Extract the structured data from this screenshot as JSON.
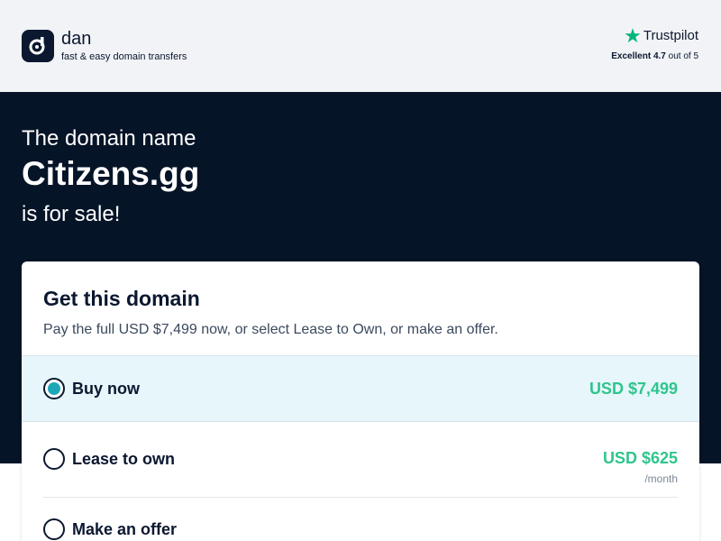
{
  "header": {
    "brand_name": "dan",
    "brand_tagline": "fast & easy domain transfers",
    "logo_icon": "dan-logo-icon",
    "trustpilot": {
      "name": "Trustpilot",
      "star_icon": "star-icon",
      "rating_word": "Excellent",
      "rating_value": "4.7",
      "rating_suffix": "out of 5"
    }
  },
  "hero": {
    "prefix": "The domain name",
    "domain": "Citizens.gg",
    "suffix": "is for sale!"
  },
  "card": {
    "title": "Get this domain",
    "subtitle": "Pay the full USD $7,499 now, or select Lease to Own, or make an offer.",
    "options": [
      {
        "label": "Buy now",
        "price": "USD $7,499",
        "unit": "",
        "selected": true
      },
      {
        "label": "Lease to own",
        "price": "USD $625",
        "unit": "/month",
        "selected": false
      },
      {
        "label": "Make an offer",
        "price": "",
        "unit": "",
        "selected": false
      }
    ]
  },
  "colors": {
    "navy": "#061428",
    "header_bg": "#f2f3f6",
    "price_green": "#2fc58c",
    "selected_bg": "#e6f6fb",
    "radio_accent": "#1ea7b9",
    "trustpilot_green": "#00b67a"
  }
}
